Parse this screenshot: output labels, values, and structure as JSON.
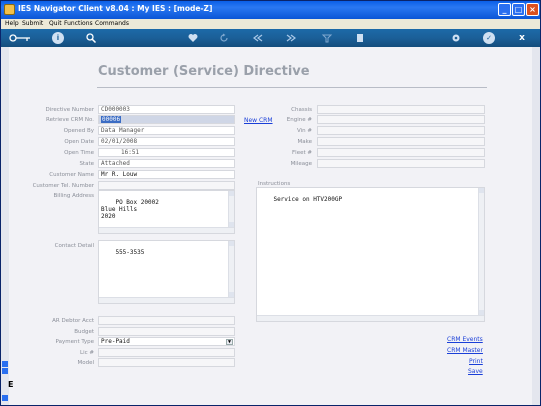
{
  "window": {
    "title": "IES Navigator Client v8.04 : My IES :       [mode-Z]"
  },
  "menu": [
    "Help",
    "Submit",
    "Quit",
    "Functions",
    "Commands"
  ],
  "toolbar": {
    "icons": [
      "key-icon",
      "info-icon",
      "search-icon",
      "heart-icon",
      "refresh-icon",
      "first-icon",
      "last-icon",
      "filter-icon",
      "clipboard-icon",
      "settings-icon",
      "check-icon",
      "close-icon"
    ],
    "info_glyph": "i",
    "check_glyph": "✓",
    "close_glyph": "x"
  },
  "page": {
    "title": "Customer (Service) Directive"
  },
  "form": {
    "directive_number": {
      "label": "Directive Number",
      "value": "CD000003"
    },
    "retrieve_crm": {
      "label": "Retrieve CRM No.",
      "value": "00006"
    },
    "opened_by": {
      "label": "Opened By",
      "value": "Data Manager"
    },
    "open_date": {
      "label": "Open Date",
      "value": "02/01/2008"
    },
    "open_time": {
      "label": "Open Time",
      "value": "16:51"
    },
    "state": {
      "label": "State",
      "value": "Attached"
    },
    "customer_name": {
      "label": "Customer Name",
      "value": "Mr R. Louw"
    },
    "customer_tel": {
      "label": "Customer Tel. Number",
      "value": ""
    },
    "billing_address": {
      "label": "Billing Address",
      "value": "PO Box 20002\nBlue Hills\n2020"
    },
    "contact_detail": {
      "label": "Contact Detail",
      "value": "555-3535"
    },
    "ar_debtor": {
      "label": "AR Debtor Acct",
      "value": ""
    },
    "budget": {
      "label": "Budget",
      "value": ""
    },
    "payment_type": {
      "label": "Payment Type",
      "value": "Pre-Paid"
    },
    "lic": {
      "label": "Lic #",
      "value": ""
    },
    "model": {
      "label": "Model",
      "value": ""
    },
    "chassis": {
      "label": "Chassis",
      "value": ""
    },
    "engine": {
      "label": "Engine #",
      "value": ""
    },
    "vin": {
      "label": "Vin #",
      "value": ""
    },
    "make": {
      "label": "Make",
      "value": ""
    },
    "fleet": {
      "label": "Fleet #",
      "value": ""
    },
    "mileage": {
      "label": "Mileage",
      "value": ""
    },
    "instructions": {
      "label": "Instructions",
      "value": "Service on HTV200GP"
    }
  },
  "links": {
    "new_crm": "New CRM",
    "crm_events": "CRM Events",
    "crm_master": "CRM Master",
    "print": "Print",
    "save": "Save"
  },
  "colors": {
    "titlebar": "#0a5fe8",
    "toolbar": "#1b5f98",
    "link": "#1a3fd8",
    "highlight": "#3b6cc4"
  }
}
